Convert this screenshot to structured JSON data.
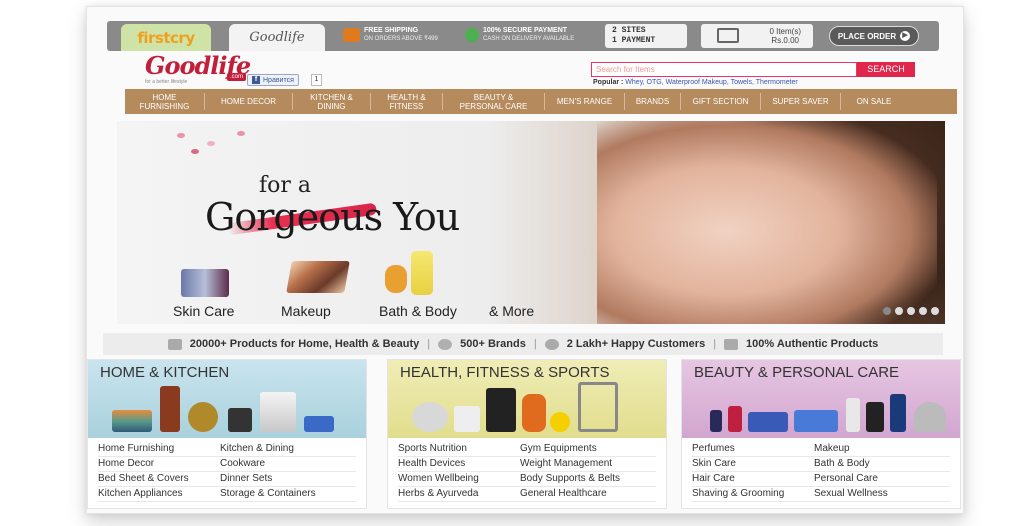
{
  "topbar": {
    "tab_firstcry": "firstcry",
    "tab_goodlife": "Goodlife",
    "shipping_title": "FREE SHIPPING",
    "shipping_sub": "ON ORDERS ABOVE ₹499",
    "payment_title": "100% SECURE PAYMENT",
    "payment_sub": "CASH ON DELIVERY AVAILABLE",
    "sites_line1": "2 SITES",
    "sites_line2": "1 PAYMENT",
    "cart_items": "0 Item(s)",
    "cart_total": "Rs.0.00",
    "place_order": "PLACE ORDER"
  },
  "header": {
    "logo": "Goodlife",
    "logo_tagline": "for a better lifestyle",
    "logo_domain": ".com",
    "fb_like": "Нравится",
    "fb_count": "1",
    "search_placeholder": "Search for Items",
    "search_button": "SEARCH",
    "popular_label": "Popular :",
    "popular_items": "Whey, OTG, Waterproof Makeup, Towels, Thermometer"
  },
  "nav": [
    "HOME\nFURNISHING",
    "HOME DECOR",
    "KITCHEN &\nDINING",
    "HEALTH &\nFITNESS",
    "BEAUTY &\nPERSONAL CARE",
    "MEN'S RANGE",
    "BRANDS",
    "GIFT SECTION",
    "SUPER SAVER",
    "ON SALE"
  ],
  "banner": {
    "line1": "for a",
    "line2": "Gorgeous You",
    "products": [
      "Skin Care",
      "Makeup",
      "Bath & Body",
      "& More"
    ]
  },
  "strip": {
    "item1": "20000+ Products for Home, Health & Beauty",
    "item2": "500+ Brands",
    "item3": "2 Lakh+ Happy Customers",
    "item4": "100% Authentic Products"
  },
  "categories": [
    {
      "title": "HOME & KITCHEN",
      "links": [
        "Home Furnishing",
        "Kitchen & Dining",
        "Home Decor",
        "Cookware",
        "Bed Sheet & Covers",
        "Dinner Sets",
        "Kitchen Appliances",
        "Storage & Containers"
      ]
    },
    {
      "title": "HEALTH, FITNESS & SPORTS",
      "links": [
        "Sports Nutrition",
        "Gym Equipments",
        "Health Devices",
        "Weight Management",
        "Women Wellbeing",
        "Body Supports & Belts",
        "Herbs & Ayurveda",
        "General Healthcare"
      ]
    },
    {
      "title": "BEAUTY & PERSONAL CARE",
      "links": [
        "Perfumes",
        "Makeup",
        "Skin Care",
        "Bath & Body",
        "Hair Care",
        "Personal Care",
        "Shaving & Grooming",
        "Sexual Wellness"
      ]
    }
  ],
  "colors": {
    "brand": "#c21e3a",
    "nav": "#b58a5c",
    "search": "#e0264a"
  }
}
